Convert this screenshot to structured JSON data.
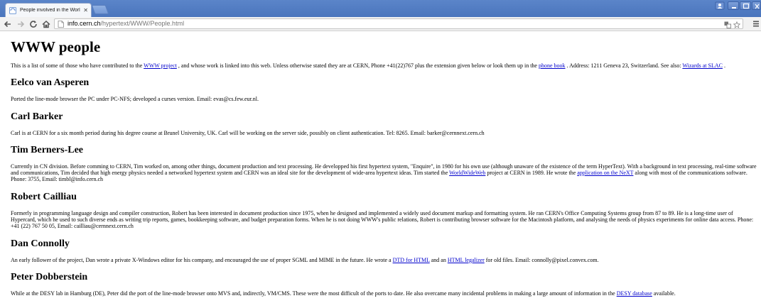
{
  "browser": {
    "tab_title": "People involved in the Worl",
    "url_prefix": "",
    "url_host": "info.cern.ch",
    "url_path": "/hypertext/WWW/People.html",
    "icons": [
      "favicon-icon",
      "close-icon",
      "new-tab-icon",
      "back-icon",
      "forward-icon",
      "reload-icon",
      "home-icon",
      "page-icon",
      "translate-icon",
      "star-icon",
      "menu-icon",
      "minimize-icon",
      "maximize-icon",
      "window-close-icon",
      "user-icon"
    ]
  },
  "page": {
    "title": "WWW people",
    "intro": {
      "t1": "This is a list of some of those who have contributed to the ",
      "link1": "WWW project",
      "t2": " , and whose work is linked into this web. Unless otherwise stated they are at CERN, Phone +41(22)767 plus the extension given below or look them up in the ",
      "link2": "phone book",
      "t3": " . Address: 1211 Geneva 23, Switzerland. See also: ",
      "link3": "Wizards at SLAC",
      "t4": " ."
    },
    "people": [
      {
        "name": "Eelco van Asperen",
        "bio": "Ported the line-mode browser the PC under PC-NFS; developed a curses version. Email: evas@cs.few.eur.nl."
      },
      {
        "name": "Carl Barker",
        "bio": "Carl is at CERN for a six month period during his degree course at Brunel University, UK. Carl will be working on the server side, possibly on client authentication. Tel: 8265. Email: barker@cernnext.cern.ch"
      },
      {
        "name": "Tim Berners-Lee",
        "t1": "Currently in CN division. Before comming to CERN, Tim worked on, among other things, document production and text processing. He developped his first hypertext system, \"Enquire\", in 1980 for his own use (although unaware of the existence of the term HyperText). With a background in text processing, real-time software and communications, Tim decided that high energy physics needed a networked hypertext system and CERN was an ideal site for the development of wide-area hypertext ideas. Tim started the ",
        "link1": "WorldWideWeb",
        "t2": " project at CERN in 1989. He wrote the ",
        "link2": "application on the NeXT",
        "t3": " along with most of the communications software. Phone: 3755, Email: timbl@info.cern.ch"
      },
      {
        "name": "Robert Cailliau",
        "bio": "Formerly in programming language design and compiler construction, Robert has been interested in document production since 1975, when he designed and implemented a widely used document markup and formatting system. He ran CERN's Office Computing Systems group from 87 to 89. He is a long-time user of Hypercard, which he used to such diverse ends as writing trip reports, games, bookkeeping software, and budget preparation forms. When he is not doing WWW's public relations, Robert is contributing browser software for the Macintosh platform, and analysing the needs of physics experiments for online data access. Phone: +41 (22) 767 50 05, Email: cailliau@cernnext.cern.ch"
      },
      {
        "name": "Dan Connolly",
        "t1": "An early follower of the project, Dan wrote a private X-Windows editor for his company, and encouraged the use of proper SGML and MIME in the future. He wrote a ",
        "link1": "DTD for HTML",
        "t2": " and an ",
        "link2": "HTML legalizer",
        "t3": " for old files. Email: connolly@pixel.convex.com."
      },
      {
        "name": "Peter Dobberstein",
        "t1": "While at the DESY lab in Hamburg (DE), Peter did the port of the line-mode browser onto MVS and, indirectly, VM/CMS. These were the most difficult of the ports to date. He also overcame many incidental problems in making a large amount of information in the ",
        "link1": "DESY database",
        "t2": " available."
      }
    ]
  }
}
